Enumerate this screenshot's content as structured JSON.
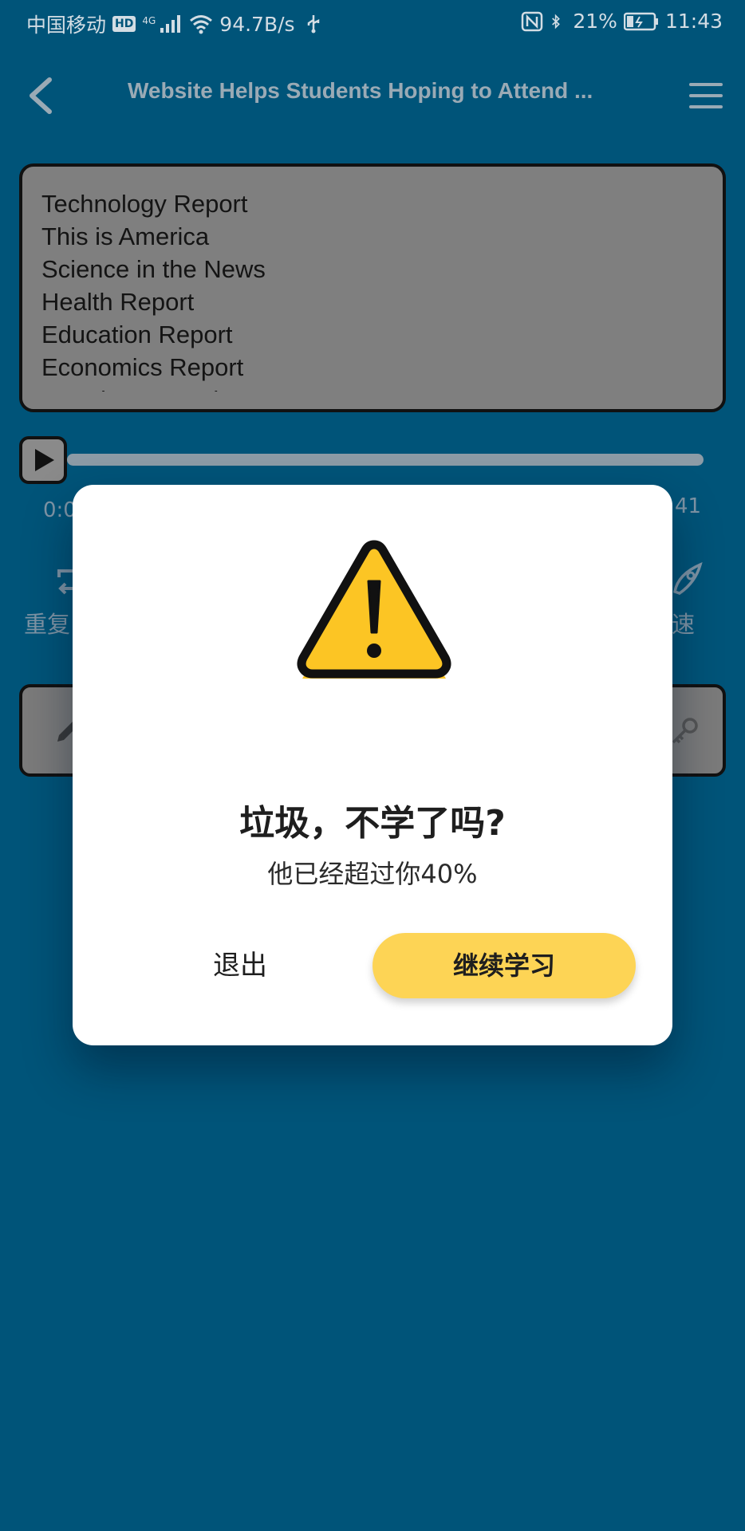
{
  "status_bar": {
    "carrier": "中国移动",
    "hd_badge": "HD",
    "network": "4G",
    "speed": "94.7B/s",
    "battery_percent": "21%",
    "time": "11:43",
    "icons": [
      "signal-icon",
      "wifi-icon",
      "usb-icon",
      "nfc-icon",
      "bluetooth-icon",
      "battery-icon"
    ]
  },
  "header": {
    "title": "Website Helps Students Hoping to Attend ...",
    "back_icon": "chevron-left-icon",
    "menu_icon": "hamburger-menu-icon"
  },
  "categories": [
    "Technology Report",
    "This is America",
    "Science in the News",
    "Health Report",
    "Education Report",
    "Economics Report",
    "American Mosaic"
  ],
  "player": {
    "play_icon": "play-icon",
    "progress": 0.0,
    "time_elapsed": "0:0",
    "time_total": "41",
    "left_control_label": "重复",
    "right_control_label": "速"
  },
  "dialog": {
    "icon": "warning-icon",
    "title": "垃圾，不学了吗?",
    "subtitle": "他已经超过你40%",
    "exit_label": "退出",
    "continue_label": "继续学习"
  },
  "colors": {
    "background": "#005479",
    "accent_button": "#fdd455",
    "warning_yellow": "#fcc524",
    "list_box": "#7f7f7f"
  }
}
